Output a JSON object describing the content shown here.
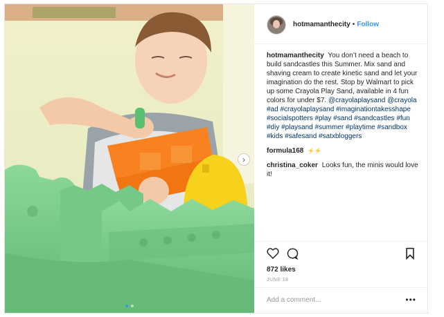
{
  "header": {
    "username": "hotmamanthecity",
    "separator": "•",
    "follow_label": "Follow"
  },
  "caption": {
    "username": "hotmamanthecity",
    "text": "You don’t need a beach to build sandcastles this Summer. Mix sand and shaving cream to create kinetic sand and let your imagination do the rest. Stop by Walmart to pick up some Crayola Play Sand, available in 4 fun colors for under $7.",
    "tags": "@crayolaplaysand @crayola #ad #crayolaplaysand #imaginationtakesshape #socialspotters #play #sand #sandcastles #fun #diy #playsand #summer #playtime #sandbox #kids #safesand #satxbloggers"
  },
  "comments": [
    {
      "username": "formula168",
      "text": "⚡⚡"
    },
    {
      "username": "christina_coker",
      "text": "Looks fun, the minis would love it!"
    }
  ],
  "stats": {
    "likes": "872 likes",
    "date": "JUNE 18"
  },
  "comment_box": {
    "placeholder": "Add a comment...",
    "more_label": "•••"
  },
  "carousel": {
    "next_glyph": "›",
    "slide_count": 2,
    "active_index": 0
  },
  "colors": {
    "link_blue": "#3897f0",
    "hashtag": "#003569",
    "sand_green": "#7fcf8c",
    "mold_orange": "#f7821f",
    "toy_yellow": "#f7d21c"
  },
  "icons": [
    "heart-icon",
    "comment-icon",
    "bookmark-icon",
    "chevron-right-icon",
    "more-options-icon"
  ]
}
